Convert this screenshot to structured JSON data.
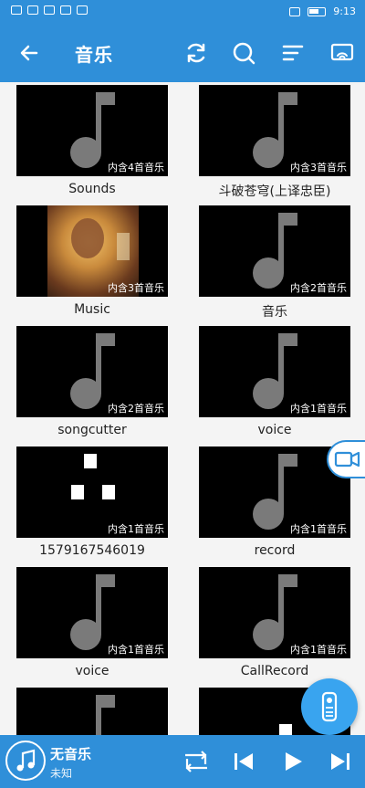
{
  "status": {
    "time": "9:13"
  },
  "header": {
    "title": "音乐"
  },
  "folders": [
    {
      "name": "Sounds",
      "count": "内含4首音乐"
    },
    {
      "name": "斗破苍穹(上译忠臣)",
      "count": "内含3首音乐"
    },
    {
      "name": "Music",
      "count": "内含3首音乐"
    },
    {
      "name": "音乐",
      "count": "内含2首音乐"
    },
    {
      "name": "songcutter",
      "count": "内含2首音乐"
    },
    {
      "name": "voice",
      "count": "内含1首音乐"
    },
    {
      "name": "1579167546019",
      "count": "内含1首音乐"
    },
    {
      "name": "record",
      "count": "内含1首音乐"
    },
    {
      "name": "voice",
      "count": "内含1首音乐"
    },
    {
      "name": "CallRecord",
      "count": "内含1首音乐"
    }
  ],
  "player": {
    "title": "无音乐",
    "artist": "未知"
  },
  "colors": {
    "primary": "#2f8fd9",
    "accent": "#39a4ef"
  },
  "icons": [
    "back-arrow-icon",
    "refresh-icon",
    "search-icon",
    "sort-icon",
    "cast-icon",
    "music-note-icon",
    "video-icon",
    "remote-icon",
    "repeat-icon",
    "previous-icon",
    "play-icon",
    "next-icon"
  ]
}
